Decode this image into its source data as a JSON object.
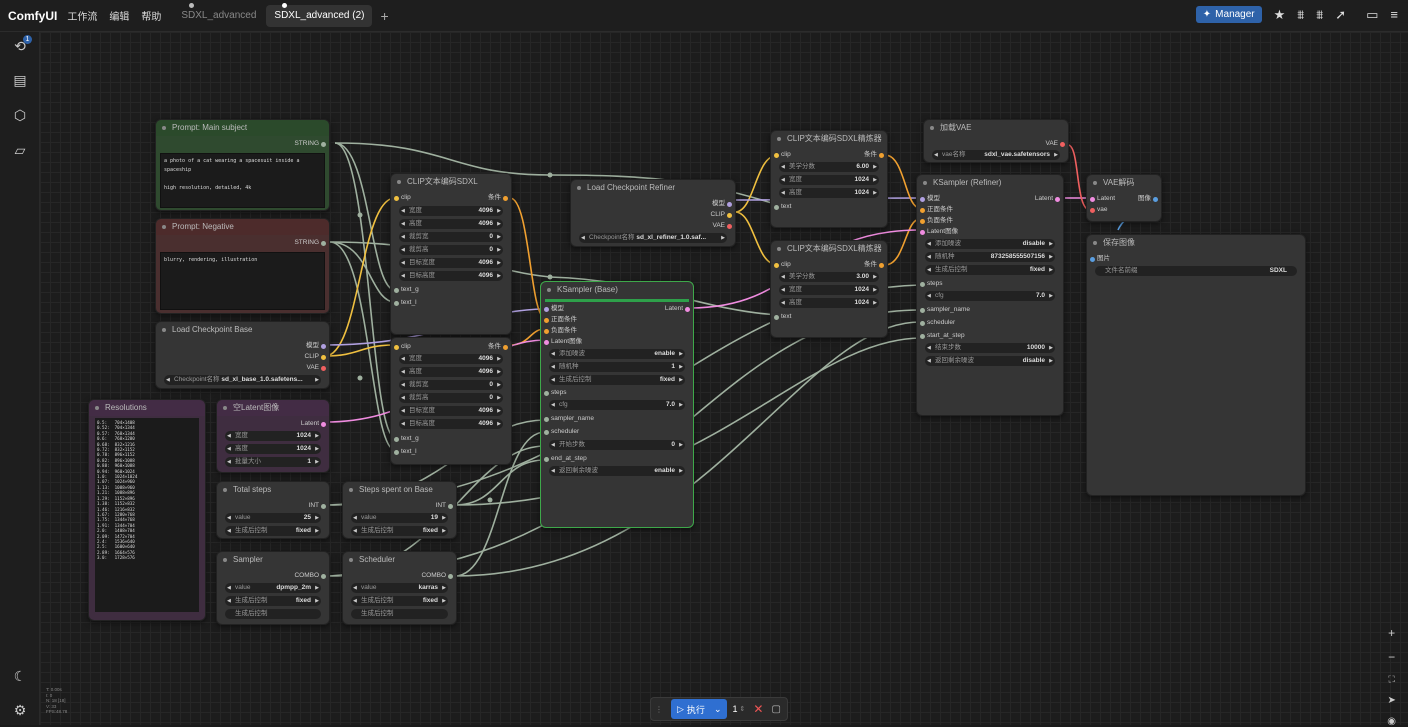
{
  "app": {
    "logo": "ComfyUI",
    "menus": [
      "工作流",
      "编辑",
      "帮助"
    ]
  },
  "tabs": [
    {
      "label": "SDXL_advanced",
      "active": false
    },
    {
      "label": "SDXL_advanced (2)",
      "active": true
    }
  ],
  "toolbar": {
    "manager_label": "Manager"
  },
  "sidebar": {
    "queue_badge": "1"
  },
  "runbar": {
    "run_label": "执行",
    "queue_count": "1"
  },
  "stats": "T: 0.00s\nI: 0\nN: 18 [18]\nV: 33\nFPS:48.78",
  "nodes": {
    "prompt_main": {
      "title": "Prompt: Main subject",
      "output": "STRING",
      "text": "a photo of a cat wearing a spacesuit inside a spaceship\n\nhigh resolution, detailed, 4k"
    },
    "prompt_neg": {
      "title": "Prompt: Negative",
      "output": "STRING",
      "text": "blurry, rendering, illustration"
    },
    "ckpt_base": {
      "title": "Load Checkpoint Base",
      "outputs": [
        "模型",
        "CLIP",
        "VAE"
      ],
      "ckpt_label": "Checkpoint名称",
      "ckpt_value": "sd_xl_base_1.0.safetens..."
    },
    "resolutions": {
      "title": "Resolutions",
      "list": "0.5:   704×1408\n0.52:  704×1344\n0.57:  768×1344\n0.6:   768×1280\n0.68:  832×1216\n0.72:  832×1152\n0.78:  896×1152\n0.82:  896×1088\n0.88:  960×1088\n0.94:  960×1024\n1.0:   1024×1024\n1.07:  1024×960\n1.13:  1088×960\n1.21:  1088×896\n1.29:  1152×896\n1.38:  1152×832\n1.46:  1216×832\n1.67:  1280×768\n1.75:  1344×768\n1.91:  1344×704\n2.0:   1408×704\n2.09:  1472×704\n2.4:   1536×640\n2.5:   1600×640\n2.89:  1664×576\n3.0:   1728×576"
    },
    "clip_sdxl": {
      "title": "CLIP文本编码SDXL",
      "input": "clip",
      "output": "条件",
      "widgets": [
        [
          "宽度",
          "4096"
        ],
        [
          "高度",
          "4096"
        ],
        [
          "裁剪宽",
          "0"
        ],
        [
          "裁剪高",
          "0"
        ],
        [
          "目标宽度",
          "4096"
        ],
        [
          "目标高度",
          "4096"
        ]
      ],
      "text_inputs": [
        "text_g",
        "text_l"
      ]
    },
    "clip_sdxl_2": {
      "input": "clip",
      "output": "条件",
      "widgets": [
        [
          "宽度",
          "4096"
        ],
        [
          "高度",
          "4096"
        ],
        [
          "裁剪宽",
          "0"
        ],
        [
          "裁剪高",
          "0"
        ],
        [
          "目标宽度",
          "4096"
        ],
        [
          "目标高度",
          "4096"
        ]
      ],
      "text_inputs": [
        "text_g",
        "text_l"
      ]
    },
    "empty_latent": {
      "title": "空Latent图像",
      "output": "Latent",
      "widgets": [
        [
          "宽度",
          "1024"
        ],
        [
          "高度",
          "1024"
        ],
        [
          "批量大小",
          "1"
        ]
      ]
    },
    "total_steps": {
      "title": "Total steps",
      "output": "INT",
      "widgets": [
        [
          "value",
          "25"
        ],
        [
          "生成后控制",
          "fixed"
        ]
      ]
    },
    "steps_base": {
      "title": "Steps spent on Base",
      "output": "INT",
      "widgets": [
        [
          "value",
          "19"
        ],
        [
          "生成后控制",
          "fixed"
        ]
      ]
    },
    "sampler": {
      "title": "Sampler",
      "output": "COMBO",
      "widgets": [
        [
          "value",
          "dpmpp_2m"
        ],
        [
          "生成后控制",
          "fixed"
        ]
      ],
      "button": "生成后控制"
    },
    "scheduler": {
      "title": "Scheduler",
      "output": "COMBO",
      "widgets": [
        [
          "value",
          "karras"
        ],
        [
          "生成后控制",
          "fixed"
        ]
      ],
      "button": "生成后控制"
    },
    "ckpt_refiner": {
      "title": "Load Checkpoint Refiner",
      "outputs": [
        "模型",
        "CLIP",
        "VAE"
      ],
      "ckpt_label": "Checkpoint名称",
      "ckpt_value": "sd_xl_refiner_1.0.saf..."
    },
    "ksampler_base": {
      "title": "KSampler (Base)",
      "inputs": [
        "模型",
        "正面条件",
        "负面条件",
        "Latent图像"
      ],
      "output": "Latent",
      "widgets": [
        [
          "添加噪波",
          "enable"
        ],
        [
          "随机种",
          "1"
        ],
        [
          "生成后控制",
          "fixed"
        ],
        [
          "cfg",
          "7.0"
        ],
        [
          "开始步数",
          "0"
        ],
        [
          "返回剩余噪波",
          "enable"
        ]
      ],
      "extra_inputs": [
        "steps",
        "sampler_name",
        "scheduler",
        "end_at_step"
      ]
    },
    "clip_ref_1": {
      "title": "CLIP文本编码SDXL精炼器",
      "input": "clip",
      "output": "条件",
      "widgets": [
        [
          "美学分数",
          "6.00"
        ],
        [
          "宽度",
          "1024"
        ],
        [
          "高度",
          "1024"
        ]
      ],
      "text_input": "text"
    },
    "clip_ref_2": {
      "title": "CLIP文本编码SDXL精炼器",
      "input": "clip",
      "output": "条件",
      "widgets": [
        [
          "美学分数",
          "3.00"
        ],
        [
          "宽度",
          "1024"
        ],
        [
          "高度",
          "1024"
        ]
      ],
      "text_input": "text"
    },
    "vae_loader": {
      "title": "加载VAE",
      "output": "VAE",
      "widget": [
        "vae名称",
        "sdxl_vae.safetensors"
      ]
    },
    "ksampler_ref": {
      "title": "KSampler (Refiner)",
      "inputs": [
        "模型",
        "正面条件",
        "负面条件",
        "Latent图像"
      ],
      "output": "Latent",
      "widgets": [
        [
          "添加噪波",
          "disable"
        ],
        [
          "随机种",
          "873258555507156"
        ],
        [
          "生成后控制",
          "fixed"
        ],
        [
          "cfg",
          "7.0"
        ],
        [
          "结束步数",
          "10000"
        ],
        [
          "返回剩余噪波",
          "disable"
        ]
      ],
      "extra_inputs": [
        "steps",
        "sampler_name",
        "scheduler",
        "start_at_step"
      ]
    },
    "vae_decode": {
      "title": "VAE解码",
      "inputs": [
        "Latent",
        "vae"
      ],
      "output": "图像"
    },
    "save_image": {
      "title": "保存图像",
      "input": "图片",
      "widget": [
        "文件名前缀",
        "SDXL"
      ]
    }
  }
}
